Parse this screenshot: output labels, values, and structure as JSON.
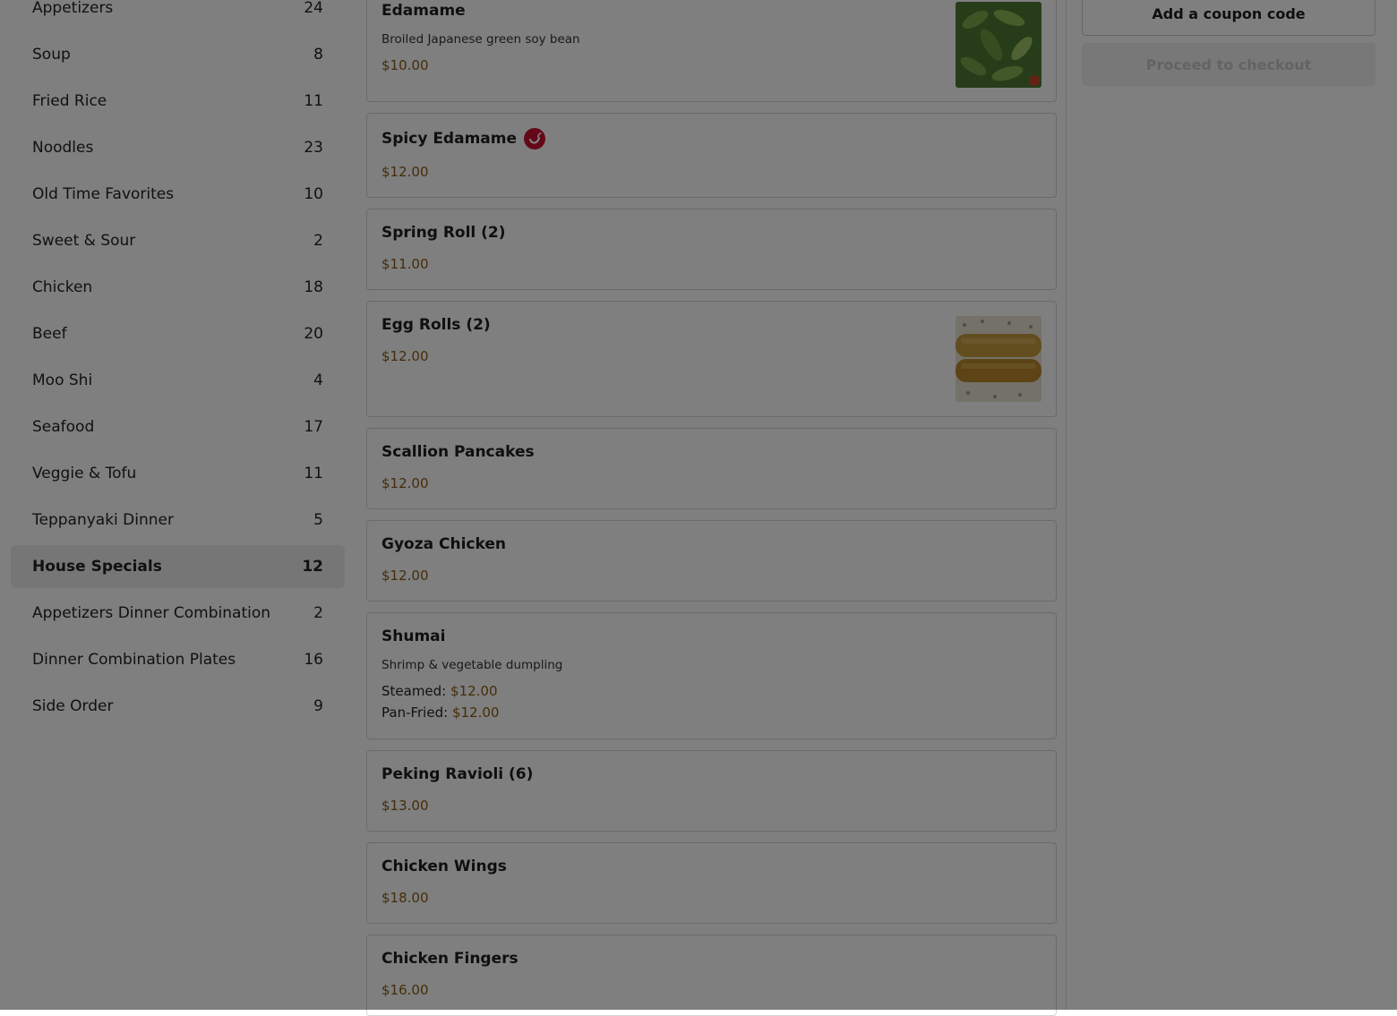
{
  "sidebar": {
    "categories": [
      {
        "label": "Appetizers",
        "count": "24"
      },
      {
        "label": "Soup",
        "count": "8"
      },
      {
        "label": "Fried Rice",
        "count": "11"
      },
      {
        "label": "Noodles",
        "count": "23"
      },
      {
        "label": "Old Time Favorites",
        "count": "10"
      },
      {
        "label": "Sweet & Sour",
        "count": "2"
      },
      {
        "label": "Chicken",
        "count": "18"
      },
      {
        "label": "Beef",
        "count": "20"
      },
      {
        "label": "Moo Shi",
        "count": "4"
      },
      {
        "label": "Seafood",
        "count": "17"
      },
      {
        "label": "Veggie & Tofu",
        "count": "11"
      },
      {
        "label": "Teppanyaki Dinner",
        "count": "5"
      },
      {
        "label": "House Specials",
        "count": "12",
        "active": true
      },
      {
        "label": "Appetizers Dinner Combination",
        "count": "2"
      },
      {
        "label": "Dinner Combination Plates",
        "count": "16"
      },
      {
        "label": "Side Order",
        "count": "9"
      }
    ]
  },
  "menu": {
    "items": [
      {
        "name": "Edamame",
        "description": "Broiled Japanese green soy bean",
        "price": "$10.00",
        "image": "edamame-photo"
      },
      {
        "name": "Spicy Edamame",
        "price": "$12.00",
        "spicy": true
      },
      {
        "name": "Spring Roll (2)",
        "price": "$11.00"
      },
      {
        "name": "Egg Rolls (2)",
        "price": "$12.00",
        "image": "egg-rolls-photo"
      },
      {
        "name": "Scallion Pancakes",
        "price": "$12.00"
      },
      {
        "name": "Gyoza Chicken",
        "price": "$12.00"
      },
      {
        "name": "Shumai",
        "description": "Shrimp & vegetable dumpling",
        "options": [
          {
            "label": "Steamed:",
            "price": "$12.00"
          },
          {
            "label": "Pan-Fried:",
            "price": "$12.00"
          }
        ]
      },
      {
        "name": "Peking Ravioli (6)",
        "price": "$13.00"
      },
      {
        "name": "Chicken Wings",
        "price": "$18.00"
      },
      {
        "name": "Chicken Fingers",
        "price": "$16.00"
      }
    ]
  },
  "cart": {
    "coupon_label": "Add a coupon code",
    "checkout_label": "Proceed to checkout"
  },
  "colors": {
    "price": "#8a5a14",
    "spicy": "#c8102e",
    "overlay": "rgba(0,0,0,0.5)"
  }
}
